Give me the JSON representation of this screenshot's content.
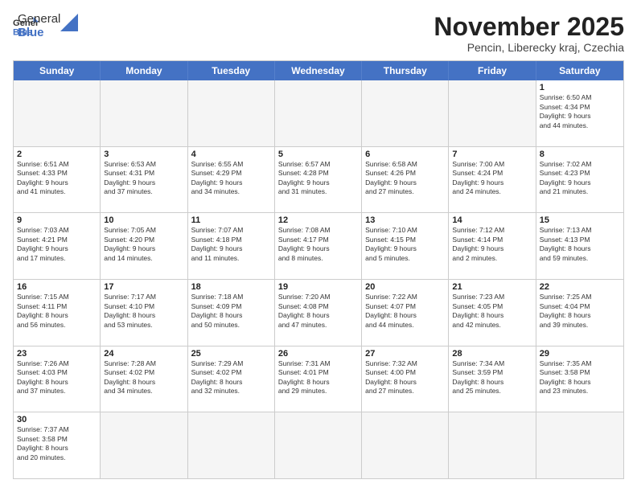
{
  "logo": {
    "text_general": "General",
    "text_blue": "Blue"
  },
  "header": {
    "month": "November 2025",
    "location": "Pencin, Liberecky kraj, Czechia"
  },
  "weekdays": [
    "Sunday",
    "Monday",
    "Tuesday",
    "Wednesday",
    "Thursday",
    "Friday",
    "Saturday"
  ],
  "rows": [
    [
      {
        "day": "",
        "empty": true
      },
      {
        "day": "",
        "empty": true
      },
      {
        "day": "",
        "empty": true
      },
      {
        "day": "",
        "empty": true
      },
      {
        "day": "",
        "empty": true
      },
      {
        "day": "",
        "empty": true
      },
      {
        "day": "1",
        "info": "Sunrise: 6:50 AM\nSunset: 4:34 PM\nDaylight: 9 hours\nand 44 minutes."
      }
    ],
    [
      {
        "day": "2",
        "info": "Sunrise: 6:51 AM\nSunset: 4:33 PM\nDaylight: 9 hours\nand 41 minutes."
      },
      {
        "day": "3",
        "info": "Sunrise: 6:53 AM\nSunset: 4:31 PM\nDaylight: 9 hours\nand 37 minutes."
      },
      {
        "day": "4",
        "info": "Sunrise: 6:55 AM\nSunset: 4:29 PM\nDaylight: 9 hours\nand 34 minutes."
      },
      {
        "day": "5",
        "info": "Sunrise: 6:57 AM\nSunset: 4:28 PM\nDaylight: 9 hours\nand 31 minutes."
      },
      {
        "day": "6",
        "info": "Sunrise: 6:58 AM\nSunset: 4:26 PM\nDaylight: 9 hours\nand 27 minutes."
      },
      {
        "day": "7",
        "info": "Sunrise: 7:00 AM\nSunset: 4:24 PM\nDaylight: 9 hours\nand 24 minutes."
      },
      {
        "day": "8",
        "info": "Sunrise: 7:02 AM\nSunset: 4:23 PM\nDaylight: 9 hours\nand 21 minutes."
      }
    ],
    [
      {
        "day": "9",
        "info": "Sunrise: 7:03 AM\nSunset: 4:21 PM\nDaylight: 9 hours\nand 17 minutes."
      },
      {
        "day": "10",
        "info": "Sunrise: 7:05 AM\nSunset: 4:20 PM\nDaylight: 9 hours\nand 14 minutes."
      },
      {
        "day": "11",
        "info": "Sunrise: 7:07 AM\nSunset: 4:18 PM\nDaylight: 9 hours\nand 11 minutes."
      },
      {
        "day": "12",
        "info": "Sunrise: 7:08 AM\nSunset: 4:17 PM\nDaylight: 9 hours\nand 8 minutes."
      },
      {
        "day": "13",
        "info": "Sunrise: 7:10 AM\nSunset: 4:15 PM\nDaylight: 9 hours\nand 5 minutes."
      },
      {
        "day": "14",
        "info": "Sunrise: 7:12 AM\nSunset: 4:14 PM\nDaylight: 9 hours\nand 2 minutes."
      },
      {
        "day": "15",
        "info": "Sunrise: 7:13 AM\nSunset: 4:13 PM\nDaylight: 8 hours\nand 59 minutes."
      }
    ],
    [
      {
        "day": "16",
        "info": "Sunrise: 7:15 AM\nSunset: 4:11 PM\nDaylight: 8 hours\nand 56 minutes."
      },
      {
        "day": "17",
        "info": "Sunrise: 7:17 AM\nSunset: 4:10 PM\nDaylight: 8 hours\nand 53 minutes."
      },
      {
        "day": "18",
        "info": "Sunrise: 7:18 AM\nSunset: 4:09 PM\nDaylight: 8 hours\nand 50 minutes."
      },
      {
        "day": "19",
        "info": "Sunrise: 7:20 AM\nSunset: 4:08 PM\nDaylight: 8 hours\nand 47 minutes."
      },
      {
        "day": "20",
        "info": "Sunrise: 7:22 AM\nSunset: 4:07 PM\nDaylight: 8 hours\nand 44 minutes."
      },
      {
        "day": "21",
        "info": "Sunrise: 7:23 AM\nSunset: 4:05 PM\nDaylight: 8 hours\nand 42 minutes."
      },
      {
        "day": "22",
        "info": "Sunrise: 7:25 AM\nSunset: 4:04 PM\nDaylight: 8 hours\nand 39 minutes."
      }
    ],
    [
      {
        "day": "23",
        "info": "Sunrise: 7:26 AM\nSunset: 4:03 PM\nDaylight: 8 hours\nand 37 minutes."
      },
      {
        "day": "24",
        "info": "Sunrise: 7:28 AM\nSunset: 4:02 PM\nDaylight: 8 hours\nand 34 minutes."
      },
      {
        "day": "25",
        "info": "Sunrise: 7:29 AM\nSunset: 4:02 PM\nDaylight: 8 hours\nand 32 minutes."
      },
      {
        "day": "26",
        "info": "Sunrise: 7:31 AM\nSunset: 4:01 PM\nDaylight: 8 hours\nand 29 minutes."
      },
      {
        "day": "27",
        "info": "Sunrise: 7:32 AM\nSunset: 4:00 PM\nDaylight: 8 hours\nand 27 minutes."
      },
      {
        "day": "28",
        "info": "Sunrise: 7:34 AM\nSunset: 3:59 PM\nDaylight: 8 hours\nand 25 minutes."
      },
      {
        "day": "29",
        "info": "Sunrise: 7:35 AM\nSunset: 3:58 PM\nDaylight: 8 hours\nand 23 minutes."
      }
    ],
    [
      {
        "day": "30",
        "info": "Sunrise: 7:37 AM\nSunset: 3:58 PM\nDaylight: 8 hours\nand 20 minutes."
      },
      {
        "day": "",
        "empty": true
      },
      {
        "day": "",
        "empty": true
      },
      {
        "day": "",
        "empty": true
      },
      {
        "day": "",
        "empty": true
      },
      {
        "day": "",
        "empty": true
      },
      {
        "day": "",
        "empty": true
      }
    ]
  ]
}
